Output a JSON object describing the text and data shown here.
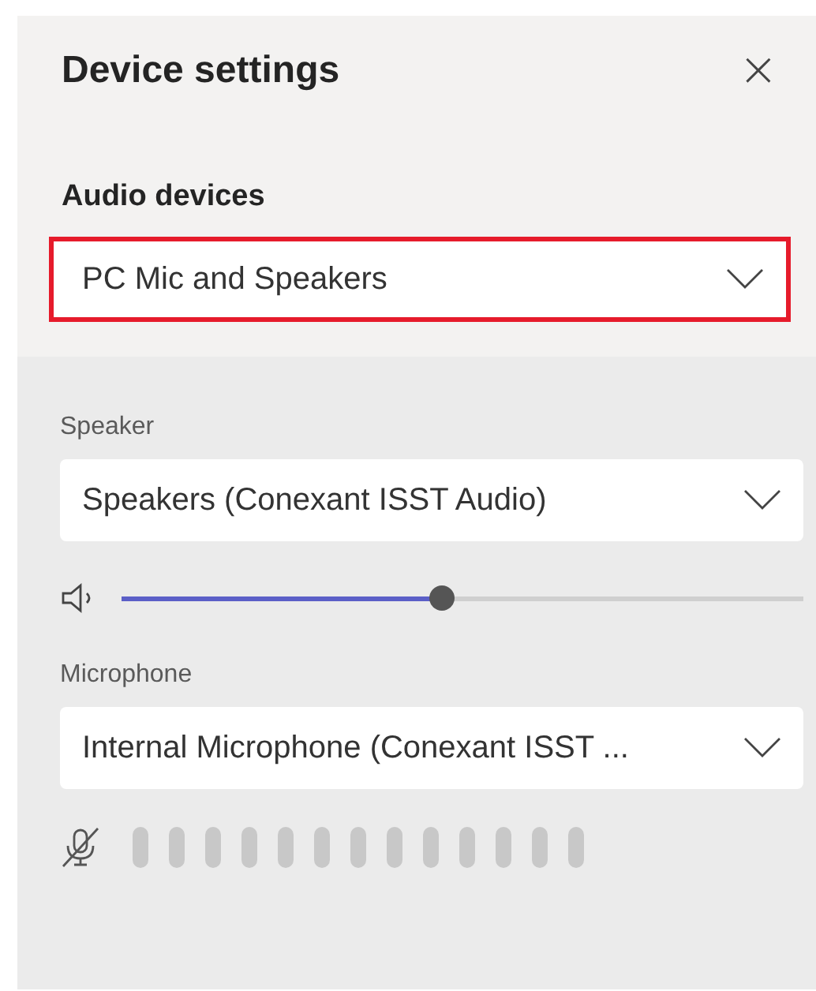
{
  "panel": {
    "title": "Device settings",
    "close_label": "×"
  },
  "audio_devices": {
    "label": "Audio devices",
    "value": "PC Mic and Speakers",
    "highlighted": true
  },
  "speaker": {
    "label": "Speaker",
    "value": "Speakers (Conexant ISST Audio)",
    "level": 0.47
  },
  "microphone": {
    "label": "Microphone",
    "value": "Internal Microphone (Conexant ISST ...",
    "muted": true,
    "meter": [
      {
        "active": false
      },
      {
        "active": false
      },
      {
        "active": false
      },
      {
        "active": false
      },
      {
        "active": false
      },
      {
        "active": false
      },
      {
        "active": false
      },
      {
        "active": false
      },
      {
        "active": false
      },
      {
        "active": false
      },
      {
        "active": false
      },
      {
        "active": false
      },
      {
        "active": false
      }
    ]
  }
}
